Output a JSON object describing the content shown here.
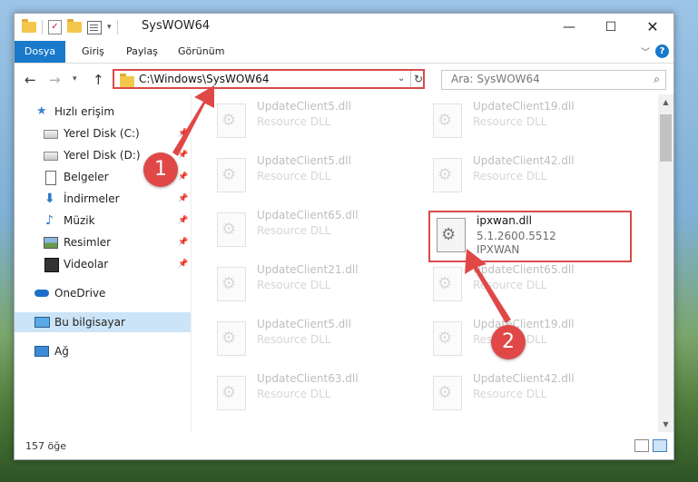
{
  "window": {
    "title": "SysWOW64",
    "minimize": "—",
    "maximize": "☐",
    "close": "✕"
  },
  "quick_access_toolbar": {
    "dropdown_glyph": "▾",
    "check_glyph": "✓"
  },
  "ribbon": {
    "tabs": [
      "Dosya",
      "Giriş",
      "Paylaş",
      "Görünüm"
    ],
    "expand_glyph": "﹀",
    "help_glyph": "?"
  },
  "navigation": {
    "back_glyph": "←",
    "forward_glyph": "→",
    "recent_glyph": "▾",
    "up_glyph": "↑",
    "address_path": "C:\\Windows\\SysWOW64",
    "address_dropdown_glyph": "⌄",
    "refresh_glyph": "↻",
    "search_placeholder": "Ara: SysWOW64",
    "search_glyph": "⌕"
  },
  "sidebar": {
    "items": [
      {
        "label": "Hızlı erişim",
        "icon": "quick-access-star-icon",
        "pinned": false
      },
      {
        "label": "Yerel Disk (C:)",
        "icon": "drive-icon",
        "pinned": true
      },
      {
        "label": "Yerel Disk (D:)",
        "icon": "drive-icon",
        "pinned": true
      },
      {
        "label": "Belgeler",
        "icon": "documents-icon",
        "pinned": true
      },
      {
        "label": "İndirmeler",
        "icon": "downloads-icon",
        "pinned": true
      },
      {
        "label": "Müzik",
        "icon": "music-icon",
        "pinned": true
      },
      {
        "label": "Resimler",
        "icon": "pictures-icon",
        "pinned": true
      },
      {
        "label": "Videolar",
        "icon": "videos-icon",
        "pinned": true
      },
      {
        "label": "OneDrive",
        "icon": "onedrive-cloud-icon",
        "pinned": false
      },
      {
        "label": "Bu bilgisayar",
        "icon": "this-pc-icon",
        "pinned": false,
        "selected": true
      },
      {
        "label": "Ağ",
        "icon": "network-icon",
        "pinned": false
      }
    ],
    "pin_glyph": "📌",
    "star_glyph": "★",
    "down_glyph": "⬇",
    "music_glyph": "♪"
  },
  "files": {
    "left_column": [
      {
        "name": "UpdateClient5.dll",
        "type": "Resource DLL"
      },
      {
        "name": "UpdateClient5.dll",
        "type": "Resource DLL"
      },
      {
        "name": "UpdateClient65.dll",
        "type": "Resource DLL"
      },
      {
        "name": "UpdateClient21.dll",
        "type": "Resource DLL"
      },
      {
        "name": "UpdateClient5.dll",
        "type": "Resource DLL"
      },
      {
        "name": "UpdateClient63.dll",
        "type": "Resource DLL"
      }
    ],
    "right_column": [
      {
        "name": "UpdateClient19.dll",
        "type": "Resource DLL"
      },
      {
        "name": "UpdateClient42.dll",
        "type": "Resource DLL"
      },
      {
        "name": "UpdateClient65.dll",
        "type": "Resource DLL"
      },
      {
        "name": "UpdateClient19.dll",
        "type": "Resource DLL"
      },
      {
        "name": "UpdateClient42.dll",
        "type": "Resource DLL"
      }
    ],
    "selected_file": {
      "name": "ipxwan.dll",
      "version": "5.1.2600.5512",
      "description": "IPXWAN"
    },
    "gear_glyph": "⚙"
  },
  "scrollbar": {
    "up_glyph": "▲",
    "down_glyph": "▼"
  },
  "statusbar": {
    "item_count": "157 öğe"
  },
  "callouts": {
    "step1": "1",
    "step2": "2",
    "accent_color": "#e04848"
  }
}
